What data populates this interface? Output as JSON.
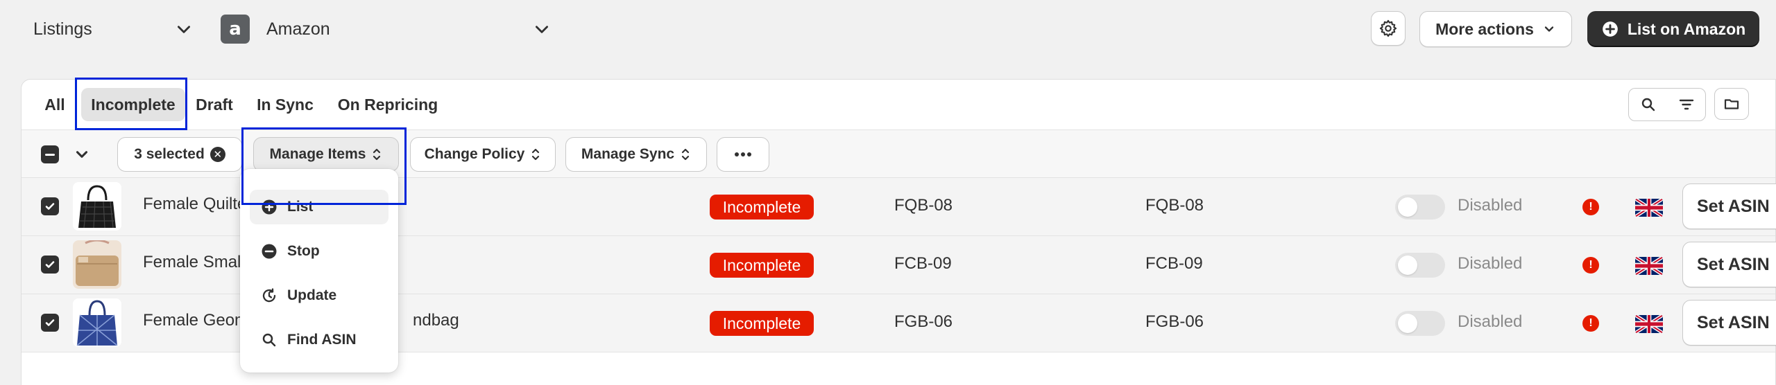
{
  "header": {
    "section_select": "Listings",
    "marketplace_logo": "a",
    "marketplace_select": "Amazon",
    "more_actions": "More actions",
    "primary_action": "List on Amazon"
  },
  "tabs": [
    {
      "label": "All",
      "active": false
    },
    {
      "label": "Incomplete",
      "active": true
    },
    {
      "label": "Draft",
      "active": false
    },
    {
      "label": "In Sync",
      "active": false
    },
    {
      "label": "On Repricing",
      "active": false
    }
  ],
  "bulk_actions": {
    "selected_count": "3 selected",
    "manage_items": "Manage Items",
    "change_policy": "Change Policy",
    "manage_sync": "Manage Sync",
    "more_icon": "ellipsis-icon"
  },
  "manage_items_menu": [
    {
      "label": "List",
      "icon": "plus-circle-icon",
      "highlighted": true
    },
    {
      "label": "Stop",
      "icon": "minus-circle-icon",
      "highlighted": false
    },
    {
      "label": "Update",
      "icon": "refresh-icon",
      "highlighted": false
    },
    {
      "label": "Find ASIN",
      "icon": "search-icon",
      "highlighted": false
    }
  ],
  "rows": [
    {
      "name": "Female Quilte",
      "status": "Incomplete",
      "sku": "FQB-08",
      "amazon_sku": "FQB-08",
      "sync": "Disabled",
      "action": "Set ASIN"
    },
    {
      "name": "Female Small",
      "status": "Incomplete",
      "sku": "FCB-09",
      "amazon_sku": "FCB-09",
      "sync": "Disabled",
      "action": "Set ASIN"
    },
    {
      "name": "Female Geom",
      "name_tail": "ndbag",
      "status": "Incomplete",
      "sku": "FGB-06",
      "amazon_sku": "FGB-06",
      "sync": "Disabled",
      "action": "Set ASIN"
    }
  ],
  "colors": {
    "status_incomplete": "#e51c00",
    "primary_button": "#303030",
    "annotation_box": "#0025d9"
  }
}
